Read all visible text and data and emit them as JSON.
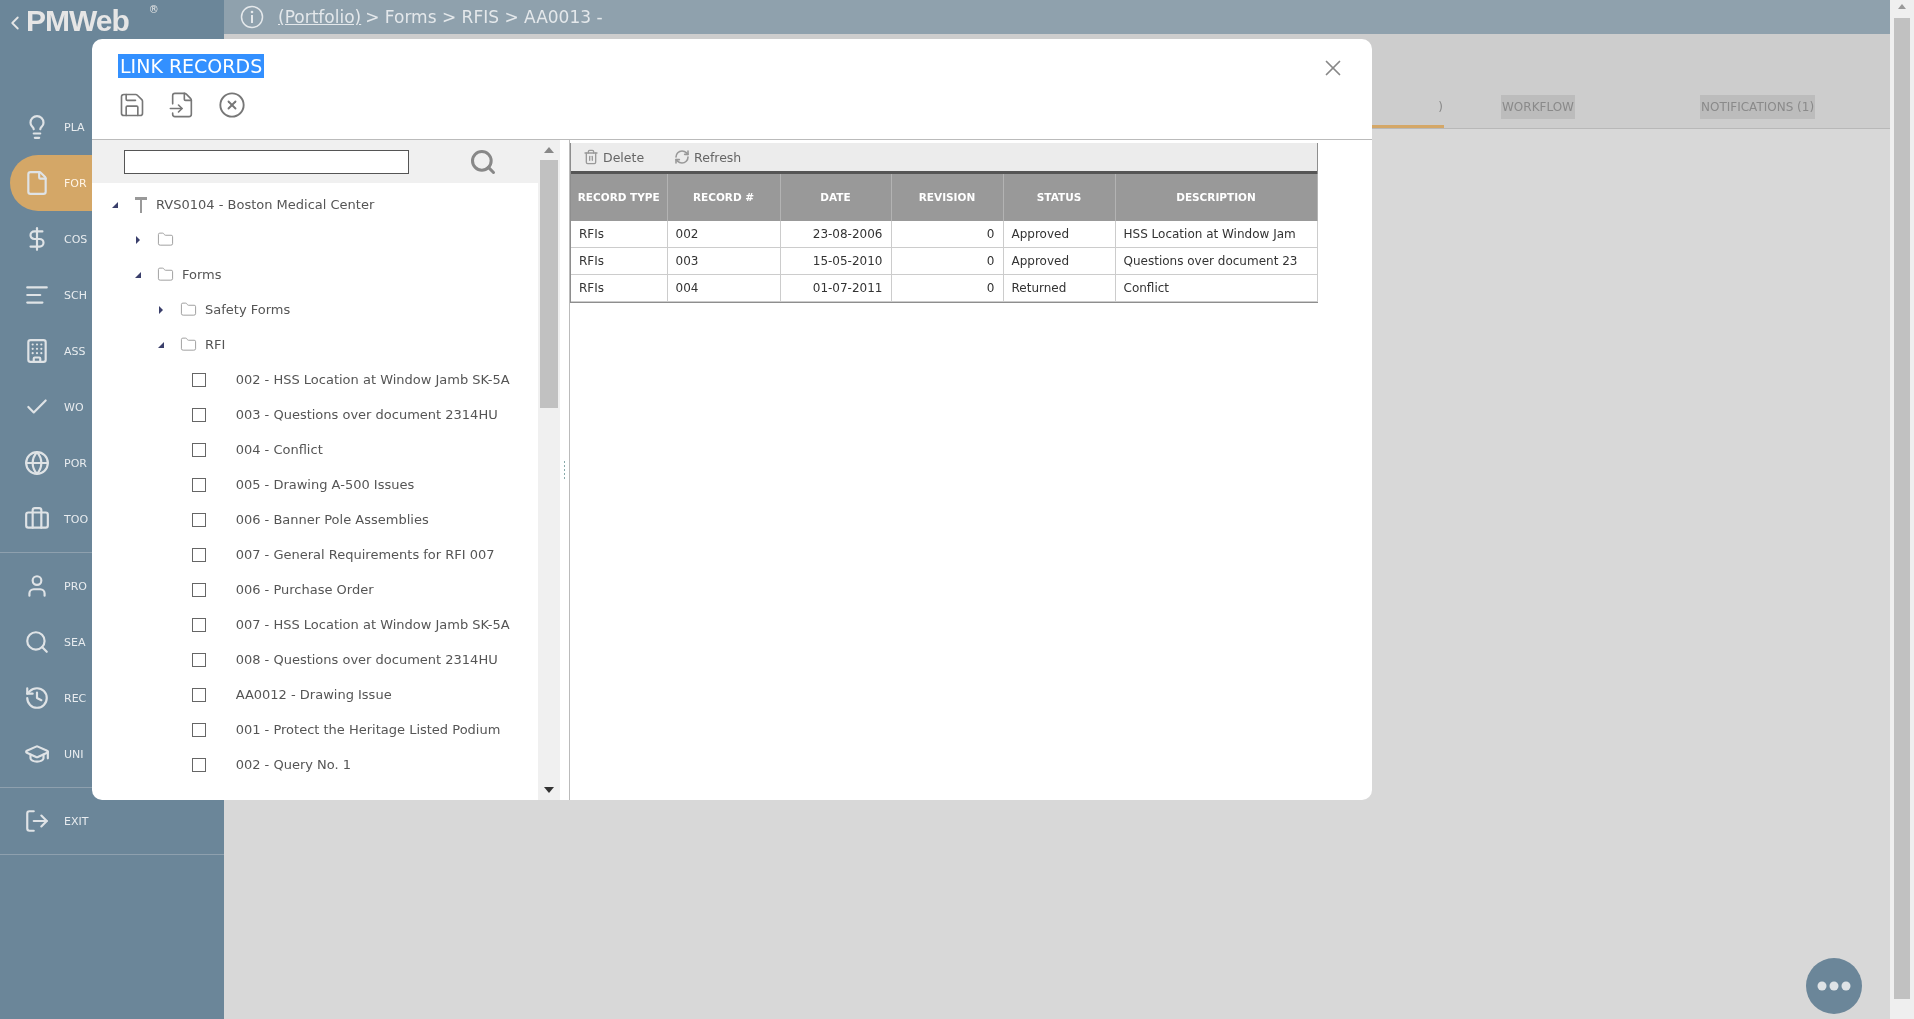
{
  "logo": {
    "name": "PMWeb",
    "mark": "®"
  },
  "breadcrumb": {
    "link": "(Portfolio)",
    "trail": "> Forms > RFIS > AA0013 -"
  },
  "sidebar": {
    "groups": [
      {
        "items": [
          {
            "label": "PLA",
            "selected": false
          },
          {
            "label": "FOR",
            "selected": true
          },
          {
            "label": "COS",
            "selected": false
          },
          {
            "label": "SCH",
            "selected": false
          },
          {
            "label": "ASS",
            "selected": false
          },
          {
            "label": "WO",
            "selected": false
          },
          {
            "label": "POR",
            "selected": false
          },
          {
            "label": "TOO",
            "selected": false
          }
        ]
      },
      {
        "items": [
          {
            "label": "PRO",
            "selected": false
          },
          {
            "label": "SEA",
            "selected": false
          },
          {
            "label": "REC",
            "selected": false
          },
          {
            "label": "UNI",
            "selected": false
          }
        ]
      },
      {
        "items": [
          {
            "label": "EXIT",
            "selected": false
          }
        ]
      }
    ]
  },
  "tabs": [
    {
      "label": ")",
      "selected": true
    },
    {
      "label": "WORKFLOW",
      "selected": false
    },
    {
      "label": "NOTIFICATIONS (1)",
      "selected": false
    }
  ],
  "dialog": {
    "title": "LINK RECORDS",
    "title_highlighted": true,
    "tree": {
      "nodes": [
        {
          "kind": "root",
          "label": "RVS0104 - Boston Medical Center",
          "expanded": true,
          "children": [
            {
              "kind": "folder",
              "expanded": false
            },
            {
              "kind": "folder",
              "label": "Forms",
              "expanded": true,
              "children": [
                {
                  "kind": "folder",
                  "label": "Safety Forms",
                  "expanded": false
                },
                {
                  "kind": "folder",
                  "label": "RFI",
                  "expanded": true,
                  "children": [
                    {
                      "kind": "record",
                      "label": "002 - HSS Location at Window Jamb SK-5A",
                      "checked": false
                    },
                    {
                      "kind": "record",
                      "label": "003 - Questions over document 2314HU",
                      "checked": false
                    },
                    {
                      "kind": "record",
                      "label": "004 - Conflict",
                      "checked": false
                    },
                    {
                      "kind": "record",
                      "label": "005 - Drawing A-500 Issues",
                      "checked": false
                    },
                    {
                      "kind": "record",
                      "label": "006 - Banner Pole Assemblies",
                      "checked": false
                    },
                    {
                      "kind": "record",
                      "label": "007 - General Requirements for RFI 007",
                      "checked": false
                    },
                    {
                      "kind": "record",
                      "label": "006 - Purchase Order",
                      "checked": false
                    },
                    {
                      "kind": "record",
                      "label": "007 - HSS Location at Window Jamb SK-5A",
                      "checked": false
                    },
                    {
                      "kind": "record",
                      "label": "008 - Questions over document 2314HU",
                      "checked": false
                    },
                    {
                      "kind": "record",
                      "label": "AA0012 - Drawing Issue",
                      "checked": false
                    },
                    {
                      "kind": "record",
                      "label": "001 - Protect the Heritage Listed Podium",
                      "checked": false
                    },
                    {
                      "kind": "record",
                      "label": "002 - Query No. 1",
                      "checked": false
                    }
                  ]
                }
              ]
            }
          ]
        }
      ]
    },
    "records": {
      "toolbar": [
        {
          "kind": "delete",
          "label": "Delete"
        },
        {
          "kind": "refresh",
          "label": "Refresh"
        }
      ],
      "columns": [
        "RECORD TYPE",
        "RECORD #",
        "DATE",
        "REVISION",
        "STATUS",
        "DESCRIPTION"
      ],
      "rows": [
        {
          "cells": [
            "RFIs",
            "002",
            "23-08-2006",
            "0",
            "Approved",
            "HSS Location at Window Jam"
          ]
        },
        {
          "cells": [
            "RFIs",
            "003",
            "15-05-2010",
            "0",
            "Approved",
            "Questions over document 23"
          ]
        },
        {
          "cells": [
            "RFIs",
            "004",
            "01-07-2011",
            "0",
            "Returned",
            "Conflict"
          ]
        }
      ]
    }
  }
}
